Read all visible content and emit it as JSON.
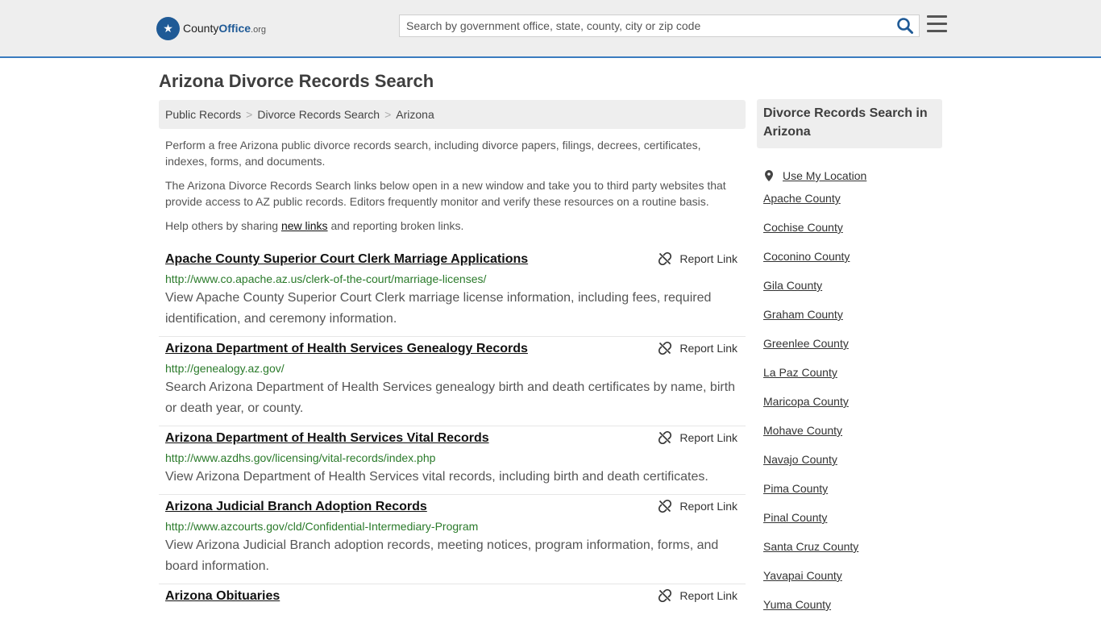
{
  "header": {
    "logo_county": "County",
    "logo_office": "Office",
    "logo_org": ".org",
    "search_placeholder": "Search by government office, state, county, city or zip code"
  },
  "page_title": "Arizona Divorce Records Search",
  "breadcrumb": [
    "Public Records",
    "Divorce Records Search",
    "Arizona"
  ],
  "intro": {
    "p1": "Perform a free Arizona public divorce records search, including divorce papers, filings, decrees, certificates, indexes, forms, and documents.",
    "p2": "The Arizona Divorce Records Search links below open in a new window and take you to third party websites that provide access to AZ public records. Editors frequently monitor and verify these resources on a routine basis.",
    "p3_before": "Help others by sharing ",
    "p3_link": "new links",
    "p3_after": " and reporting broken links."
  },
  "report_label": "Report Link",
  "listings": [
    {
      "title": "Apache County Superior Court Clerk Marriage Applications",
      "url": "http://www.co.apache.az.us/clerk-of-the-court/marriage-licenses/",
      "desc": "View Apache County Superior Court Clerk marriage license information, including fees, required identification, and ceremony information."
    },
    {
      "title": "Arizona Department of Health Services Genealogy Records",
      "url": "http://genealogy.az.gov/",
      "desc": "Search Arizona Department of Health Services genealogy birth and death certificates by name, birth or death year, or county."
    },
    {
      "title": "Arizona Department of Health Services Vital Records",
      "url": "http://www.azdhs.gov/licensing/vital-records/index.php",
      "desc": "View Arizona Department of Health Services vital records, including birth and death certificates."
    },
    {
      "title": "Arizona Judicial Branch Adoption Records",
      "url": "http://www.azcourts.gov/cld/Confidential-Intermediary-Program",
      "desc": "View Arizona Judicial Branch adoption records, meeting notices, program information, forms, and board information."
    },
    {
      "title": "Arizona Obituaries",
      "url": "",
      "desc": ""
    }
  ],
  "sidebar": {
    "heading": "Divorce Records Search in Arizona",
    "location_label": "Use My Location",
    "counties": [
      "Apache County",
      "Cochise County",
      "Coconino County",
      "Gila County",
      "Graham County",
      "Greenlee County",
      "La Paz County",
      "Maricopa County",
      "Mohave County",
      "Navajo County",
      "Pima County",
      "Pinal County",
      "Santa Cruz County",
      "Yavapai County",
      "Yuma County"
    ]
  }
}
